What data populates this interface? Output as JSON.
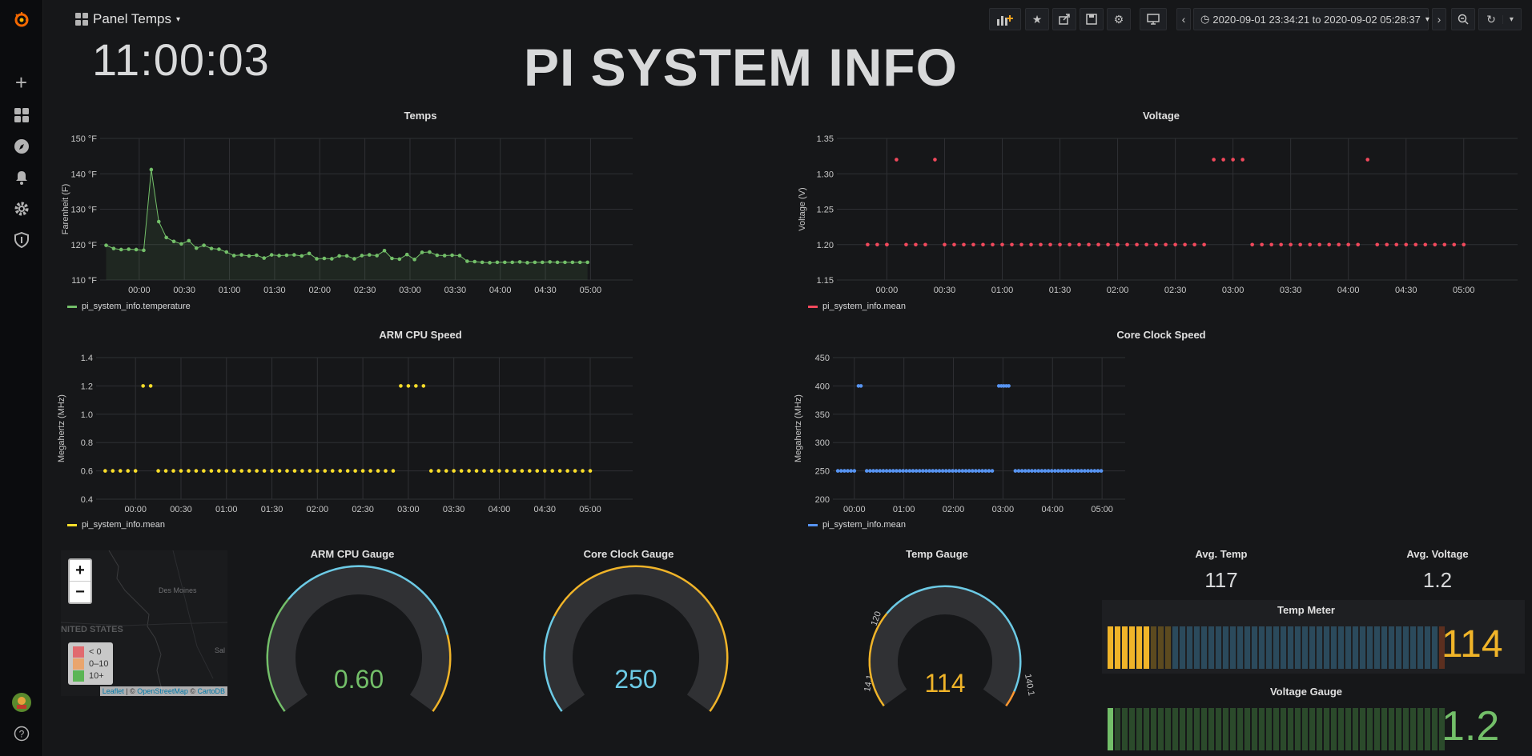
{
  "sidebar": {
    "items": [
      {
        "name": "grafana-logo-icon",
        "glyph": "✺"
      },
      {
        "name": "create-plus-icon",
        "glyph": "+"
      },
      {
        "name": "dashboards-icon",
        "glyph": "▦"
      },
      {
        "name": "explore-compass-icon",
        "glyph": "✪"
      },
      {
        "name": "alerting-bell-icon",
        "glyph": "🔔"
      },
      {
        "name": "configuration-gear-icon",
        "glyph": "⚙"
      },
      {
        "name": "server-admin-shield-icon",
        "glyph": "⛉"
      }
    ],
    "help_glyph": "?"
  },
  "topbar": {
    "dashboard_title": "Panel Temps",
    "time_range": "2020-09-01 23:34:21 to 2020-09-02 05:28:37"
  },
  "header": {
    "clock": "11:00:03",
    "title": "PI SYSTEM INFO"
  },
  "colors": {
    "green": "#73bf69",
    "red": "#f2495c",
    "yellow": "#fade2a",
    "amber": "#f0b429",
    "blue": "#5794f2",
    "cyan": "#6ccae5",
    "orange": "#ff9830"
  },
  "chart_data": [
    {
      "id": "temps",
      "type": "line",
      "title": "Temps",
      "ylabel": "Farenheit (F)",
      "ylim": [
        110,
        150
      ],
      "yticks": [
        "110 °F",
        "120 °F",
        "130 °F",
        "140 °F",
        "150 °F"
      ],
      "xticks": [
        "00:00",
        "00:30",
        "01:00",
        "01:30",
        "02:00",
        "02:30",
        "03:00",
        "03:30",
        "04:00",
        "04:30",
        "05:00"
      ],
      "x_start": "23:34",
      "x_end": "05:28",
      "series": [
        {
          "name": "pi_system_info.temperature",
          "color": "#73bf69",
          "x": [
            "23:38",
            "23:43",
            "23:48",
            "23:53",
            "23:58",
            "00:03",
            "00:08",
            "00:13",
            "00:18",
            "00:23",
            "00:28",
            "00:33",
            "00:38",
            "00:43",
            "00:48",
            "00:53",
            "00:58",
            "01:03",
            "01:08",
            "01:13",
            "01:18",
            "01:23",
            "01:28",
            "01:33",
            "01:38",
            "01:43",
            "01:48",
            "01:53",
            "01:58",
            "02:03",
            "02:08",
            "02:13",
            "02:18",
            "02:23",
            "02:28",
            "02:33",
            "02:38",
            "02:43",
            "02:48",
            "02:53",
            "02:58",
            "03:03",
            "03:08",
            "03:13",
            "03:18",
            "03:23",
            "03:28",
            "03:33",
            "03:38",
            "03:43",
            "03:48",
            "03:53",
            "03:58",
            "04:03",
            "04:08",
            "04:13",
            "04:18",
            "04:23",
            "04:28",
            "04:33",
            "04:38",
            "04:43",
            "04:48",
            "04:53",
            "04:58"
          ],
          "values": [
            119.8,
            118.9,
            118.6,
            118.7,
            118.6,
            118.4,
            141.2,
            126.5,
            122.0,
            120.9,
            120.2,
            121.1,
            119.0,
            119.8,
            118.9,
            118.7,
            117.9,
            116.9,
            117.1,
            116.8,
            117.0,
            116.2,
            117.1,
            116.9,
            117.0,
            117.1,
            116.8,
            117.5,
            116.0,
            116.1,
            116.0,
            116.8,
            116.8,
            116.0,
            116.9,
            117.1,
            116.9,
            118.3,
            116.1,
            115.9,
            117.2,
            115.8,
            117.8,
            117.9,
            117.0,
            116.9,
            117.0,
            116.9,
            115.3,
            115.2,
            115.0,
            114.9,
            115.0,
            115.0,
            115.0,
            115.1,
            114.9,
            115.0,
            115.0,
            115.1,
            115.0,
            115.0,
            115.0,
            115.0,
            115.0
          ]
        }
      ]
    },
    {
      "id": "voltage",
      "type": "scatter",
      "title": "Voltage",
      "ylabel": "Voltage (V)",
      "ylim": [
        1.15,
        1.35
      ],
      "yticks": [
        "1.15",
        "1.20",
        "1.25",
        "1.30",
        "1.35"
      ],
      "xticks": [
        "00:00",
        "00:30",
        "01:00",
        "01:30",
        "02:00",
        "02:30",
        "03:00",
        "03:30",
        "04:00",
        "04:30",
        "05:00"
      ],
      "x_start": "23:34",
      "x_end": "05:28",
      "series": [
        {
          "name": "pi_system_info.mean",
          "color": "#f2495c",
          "high_x": [
            "00:05",
            "00:25",
            "02:50",
            "02:55",
            "03:00",
            "03:05",
            "04:10"
          ],
          "high_value": 1.32,
          "low_value": 1.2,
          "low_x": [
            "23:50",
            "23:55",
            "24:00",
            "00:00",
            "00:10",
            "00:15",
            "00:20",
            "00:30",
            "00:35",
            "00:40",
            "00:45",
            "00:50",
            "00:55",
            "01:00",
            "01:05",
            "01:10",
            "01:15",
            "01:20",
            "01:25",
            "01:30",
            "01:35",
            "01:40",
            "01:45",
            "01:50",
            "01:55",
            "02:00",
            "02:05",
            "02:10",
            "02:15",
            "02:20",
            "02:25",
            "02:30",
            "02:35",
            "02:40",
            "02:45",
            "03:10",
            "03:15",
            "03:20",
            "03:25",
            "03:30",
            "03:35",
            "03:40",
            "03:45",
            "03:50",
            "03:55",
            "04:00",
            "04:05",
            "04:15",
            "04:20",
            "04:25",
            "04:30",
            "04:35",
            "04:40",
            "04:45",
            "04:50",
            "04:55",
            "05:00"
          ]
        }
      ]
    },
    {
      "id": "arm",
      "type": "scatter",
      "title": "ARM CPU Speed",
      "ylabel": "Megahertz (MHz)",
      "ylim": [
        0.4,
        1.4
      ],
      "yticks": [
        "0.4",
        "0.6",
        "0.8",
        "1.0",
        "1.2",
        "1.4"
      ],
      "xticks": [
        "00:00",
        "00:30",
        "01:00",
        "01:30",
        "02:00",
        "02:30",
        "03:00",
        "03:30",
        "04:00",
        "04:30",
        "05:00"
      ],
      "x_start": "23:34",
      "x_end": "05:28",
      "series": [
        {
          "name": "pi_system_info.mean",
          "color": "#fade2a",
          "high_x": [
            "00:05",
            "00:10",
            "02:55",
            "03:00",
            "03:05",
            "03:10"
          ],
          "high_value": 1.2,
          "low_value": 0.6,
          "low_x": [
            "23:40",
            "23:45",
            "23:50",
            "23:55",
            "24:00",
            "00:15",
            "00:20",
            "00:25",
            "00:30",
            "00:35",
            "00:40",
            "00:45",
            "00:50",
            "00:55",
            "01:00",
            "01:05",
            "01:10",
            "01:15",
            "01:20",
            "01:25",
            "01:30",
            "01:35",
            "01:40",
            "01:45",
            "01:50",
            "01:55",
            "02:00",
            "02:05",
            "02:10",
            "02:15",
            "02:20",
            "02:25",
            "02:30",
            "02:35",
            "02:40",
            "02:45",
            "02:50",
            "03:15",
            "03:20",
            "03:25",
            "03:30",
            "03:35",
            "03:40",
            "03:45",
            "03:50",
            "03:55",
            "04:00",
            "04:05",
            "04:10",
            "04:15",
            "04:20",
            "04:25",
            "04:30",
            "04:35",
            "04:40",
            "04:45",
            "04:50",
            "04:55",
            "05:00"
          ]
        }
      ]
    },
    {
      "id": "core",
      "type": "scatter",
      "title": "Core Clock Speed",
      "ylabel": "Megahertz (MHz)",
      "ylim": [
        200,
        450
      ],
      "yticks": [
        "200",
        "250",
        "300",
        "350",
        "400",
        "450"
      ],
      "xticks": [
        "00:00",
        "01:00",
        "02:00",
        "03:00",
        "04:00",
        "05:00"
      ],
      "x_start": "23:34",
      "x_end": "05:28",
      "series": [
        {
          "name": "pi_system_info.mean",
          "color": "#5794f2",
          "high_x": [
            "00:05",
            "00:08",
            "02:55",
            "02:58",
            "03:01",
            "03:04",
            "03:07"
          ],
          "high_value": 400,
          "low_value": 250,
          "low_x": [
            "23:40",
            "23:44",
            "23:48",
            "23:52",
            "23:56",
            "00:00",
            "00:15",
            "00:19",
            "00:23",
            "00:27",
            "00:31",
            "00:35",
            "00:39",
            "00:43",
            "00:47",
            "00:51",
            "00:55",
            "00:59",
            "01:03",
            "01:07",
            "01:11",
            "01:15",
            "01:19",
            "01:23",
            "01:27",
            "01:31",
            "01:35",
            "01:39",
            "01:43",
            "01:47",
            "01:51",
            "01:55",
            "01:59",
            "02:03",
            "02:07",
            "02:11",
            "02:15",
            "02:19",
            "02:23",
            "02:27",
            "02:31",
            "02:35",
            "02:39",
            "02:43",
            "02:47",
            "03:15",
            "03:19",
            "03:23",
            "03:27",
            "03:31",
            "03:35",
            "03:39",
            "03:43",
            "03:47",
            "03:51",
            "03:55",
            "03:59",
            "04:03",
            "04:07",
            "04:11",
            "04:15",
            "04:19",
            "04:23",
            "04:27",
            "04:31",
            "04:35",
            "04:39",
            "04:43",
            "04:47",
            "04:51",
            "04:55",
            "04:59"
          ]
        }
      ]
    }
  ],
  "map": {
    "zoom_in": "+",
    "zoom_out": "−",
    "labels": [
      "Des Moines",
      "NITED STATES",
      "Sal"
    ],
    "legend": [
      {
        "label": "< 0",
        "color": "#e16a6f"
      },
      {
        "label": "0–10",
        "color": "#e9a56e"
      },
      {
        "label": "10+",
        "color": "#5bb555"
      }
    ],
    "attribution": [
      "Leaflet",
      " | © ",
      "OpenStreetMap",
      " © ",
      "CartoDB"
    ]
  },
  "gauges": {
    "arm": {
      "title": "ARM CPU Gauge",
      "value": "0.60",
      "fraction": 0.6,
      "color": "#73bf69"
    },
    "core": {
      "title": "Core Clock Gauge",
      "value": "250",
      "fraction": 0.25,
      "color": "#6ccae5"
    },
    "temp": {
      "title": "Temp Gauge",
      "value": "114",
      "fraction": 0.5,
      "color": "#f0b429",
      "threshold_labels": [
        "120",
        "14.1",
        "140.1"
      ]
    }
  },
  "stats": {
    "avg_temp": {
      "title": "Avg. Temp",
      "value": "117"
    },
    "avg_voltage": {
      "title": "Avg. Voltage",
      "value": "1.2"
    }
  },
  "bar_gauges": {
    "temp_meter": {
      "title": "Temp Meter",
      "value": "114",
      "color": "#f0b429",
      "fill": 0.12
    },
    "voltage_gauge": {
      "title": "Voltage Gauge",
      "value": "1.2",
      "color": "#73bf69",
      "fill": 0.02
    }
  }
}
